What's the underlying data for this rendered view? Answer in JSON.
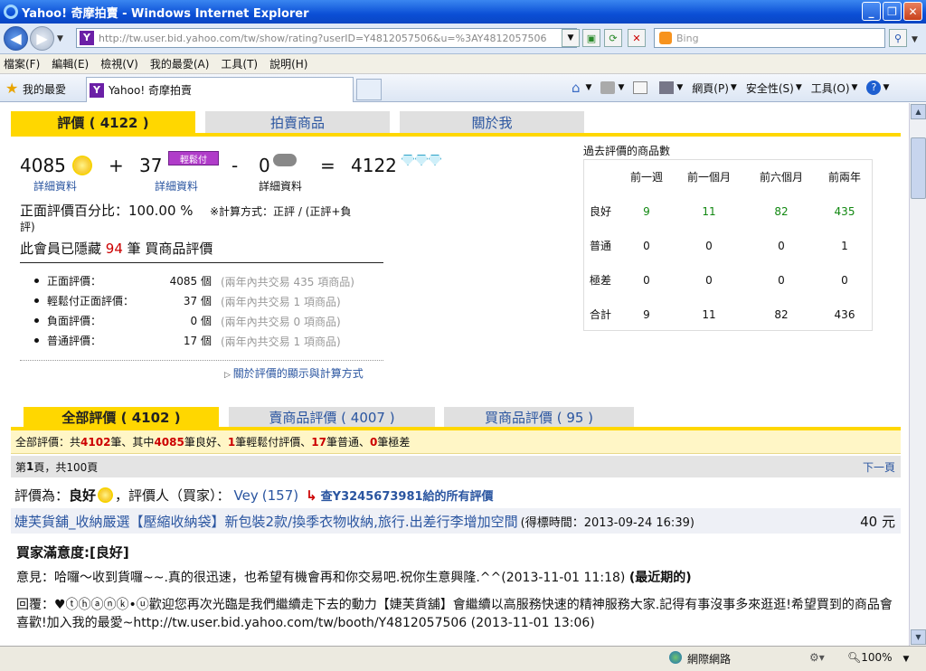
{
  "window": {
    "title": "Yahoo! 奇摩拍賣 - Windows Internet Explorer"
  },
  "address_bar": {
    "url": "http://tw.user.bid.yahoo.com/tw/show/rating?userID=Y4812057506&u=%3AY4812057506",
    "search_placeholder": "Bing"
  },
  "menu": [
    "檔案(F)",
    "編輯(E)",
    "檢視(V)",
    "我的最愛(A)",
    "工具(T)",
    "說明(H)"
  ],
  "favorites": {
    "label": "我的最愛",
    "tab_title": "Yahoo! 奇摩拍賣"
  },
  "command_bar": {
    "page": "網頁(P)",
    "safety": "安全性(S)",
    "tools": "工具(O)"
  },
  "top_tabs": [
    "評價 ( 4122 )",
    "拍賣商品",
    "關於我"
  ],
  "score": {
    "positive": "4085",
    "easy": "37",
    "negative": "0",
    "total": "4122",
    "plus": "+",
    "minus": "-",
    "equals": "=",
    "easy_badge": "輕鬆付",
    "detail": "詳細資料",
    "positive_pct_label": "正面評價百分比：",
    "positive_pct": "100.00 %",
    "calc_note_a": "※計算方式：正評 / (正評+負",
    "calc_note_b": "評)",
    "hidden_a": "此會員已隱藏 ",
    "hidden_count": "94",
    "hidden_b": " 筆 買商品評價"
  },
  "stats": [
    {
      "label": "正面評價：",
      "count": "4085 個",
      "note": "(兩年內共交易 435 項商品)"
    },
    {
      "label": "輕鬆付正面評價：",
      "count": "37 個",
      "note": "(兩年內共交易 1 項商品)"
    },
    {
      "label": "負面評價：",
      "count": "0 個",
      "note": "(兩年內共交易 0 項商品)"
    },
    {
      "label": "普通評價：",
      "count": "17 個",
      "note": "(兩年內共交易 1 項商品)"
    }
  ],
  "how_link": "關於評價的顯示與計算方式",
  "past": {
    "title": "過去評價的商品數",
    "headers": [
      "前一週",
      "前一個月",
      "前六個月",
      "前兩年"
    ],
    "rows": [
      {
        "label": "良好",
        "values": [
          "9",
          "11",
          "82",
          "435"
        ]
      },
      {
        "label": "普通",
        "values": [
          "0",
          "0",
          "0",
          "1"
        ]
      },
      {
        "label": "極差",
        "values": [
          "0",
          "0",
          "0",
          "0"
        ]
      },
      {
        "label": "合計",
        "values": [
          "9",
          "11",
          "82",
          "436"
        ]
      }
    ]
  },
  "review_tabs": [
    "全部評價 ( 4102 )",
    "賣商品評價 ( 4007 )",
    "買商品評價 ( 95 )"
  ],
  "summary": {
    "p1": "全部評價：共 ",
    "total": "4102",
    "p2": " 筆、其中 ",
    "good": "4085",
    "p3": " 筆良好、",
    "easy": "1",
    "p4": " 筆輕鬆付評價、",
    "normal": "17",
    "p5": " 筆普通、",
    "bad": "0",
    "p6": " 筆極差"
  },
  "pager": {
    "p1": "第 ",
    "page": "1",
    "p2": " 頁，共100頁",
    "next": "下一頁"
  },
  "review": {
    "rate_label": "評價為：",
    "rate": "良好",
    "rater_label": "，評價人（買家）：",
    "rater": "Vey",
    "rater_score": "(157)",
    "see_all": "查Y3245673981給的所有評價",
    "item_title": "婕芙貨舖_收納嚴選【壓縮收納袋】新包裝2款/換季衣物收納,旅行.出差行李增加空間",
    "item_time": "(得標時間：2013-09-24 16:39)",
    "price": "40 元",
    "satisfaction": "買家滿意度:[良好]",
    "opinion": "意見：哈囉～收到貨囉~~.真的很迅速，也希望有機會再和你交易吧.祝你生意興隆.^^(2013-11-01 11:18)",
    "latest": "(最近期的)",
    "reply": "回覆：♥ⓣⓗⓐⓝⓚ•ⓤ歡迎您再次光臨是我們繼續走下去的動力【婕芙貨舖】會繼續以高服務快速的精神服務大家.記得有事沒事多來逛逛!希望買到的商品會喜歡!加入我的最愛~http://tw.user.bid.yahoo.com/tw/booth/Y4812057506 (2013-11-01 13:06)"
  },
  "status": {
    "zone": "網際網路",
    "zoom": "100%"
  }
}
